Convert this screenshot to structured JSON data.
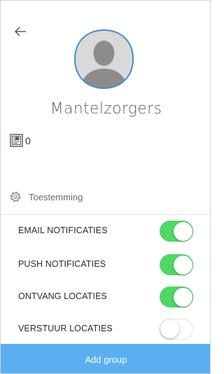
{
  "header": {
    "back_icon": "arrow-left-icon",
    "avatar_icon": "person-silhouette-icon"
  },
  "group": {
    "name": "Mantelzorgers",
    "count_icon": "document-icon",
    "count": "0"
  },
  "permission": {
    "icon": "gear-icon",
    "label": "Toestemming"
  },
  "settings": [
    {
      "label": "EMAIL NOTIFICATIES",
      "enabled": true
    },
    {
      "label": "PUSH NOTIFICATIES",
      "enabled": true
    },
    {
      "label": "ONTVANG LOCATIES",
      "enabled": true
    },
    {
      "label": "VERSTUUR LOCATIES",
      "enabled": false
    }
  ],
  "footer": {
    "add_group_label": "Add group"
  },
  "colors": {
    "toggle_on": "#4cd964",
    "avatar_border": "#3d8fd6",
    "footer_button": "#5aaff0"
  }
}
